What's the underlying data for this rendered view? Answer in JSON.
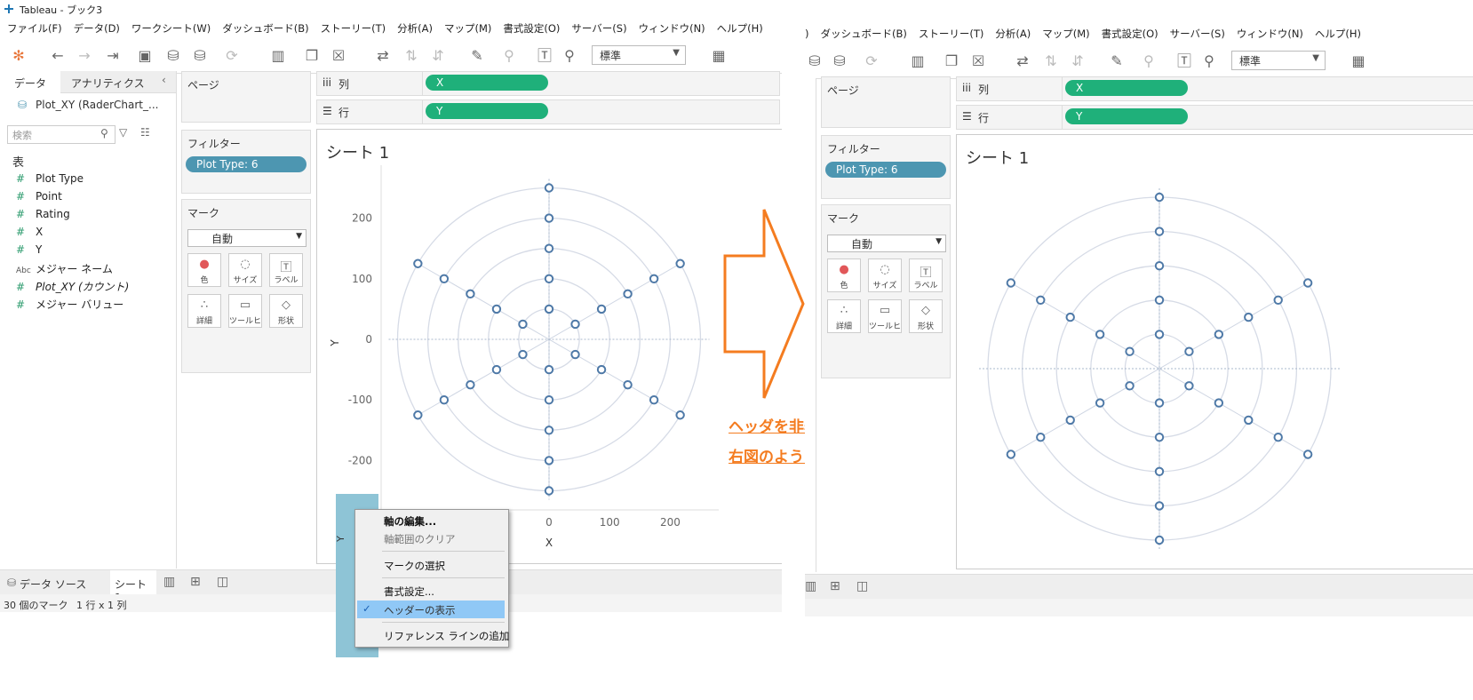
{
  "window": {
    "title": "Tableau - ブック3"
  },
  "menu": [
    "ファイル(F)",
    "データ(D)",
    "ワークシート(W)",
    "ダッシュボード(B)",
    "ストーリー(T)",
    "分析(A)",
    "マップ(M)",
    "書式設定(O)",
    "サーバー(S)",
    "ウィンドウ(N)",
    "ヘルプ(H)"
  ],
  "menu_right": ")",
  "toolbar": {
    "standard_label": "標準"
  },
  "data_pane": {
    "tab_data": "データ",
    "tab_analytics": "アナリティクス",
    "datasource": "Plot_XY (RaderChart_...",
    "search_placeholder": "検索",
    "table_header": "表",
    "fields": [
      {
        "name": "Plot Type",
        "type": "measure"
      },
      {
        "name": "Point",
        "type": "measure"
      },
      {
        "name": "Rating",
        "type": "measure"
      },
      {
        "name": "X",
        "type": "measure"
      },
      {
        "name": "Y",
        "type": "measure"
      },
      {
        "name": "メジャー ネーム",
        "type": "dimension-abc"
      },
      {
        "name": "Plot_XY (カウント)",
        "type": "measure"
      },
      {
        "name": "メジャー バリュー",
        "type": "measure"
      }
    ]
  },
  "cards": {
    "pages_title": "ページ",
    "filters_title": "フィルター",
    "filter_pill": "Plot Type: 6",
    "marks_title": "マーク",
    "marks_type": "自動",
    "mark_buttons": [
      "色",
      "サイズ",
      "ラベル",
      "詳細",
      "ツールヒ...",
      "形状"
    ]
  },
  "shelves": {
    "columns_label": "列",
    "rows_label": "行",
    "columns_pill": "X",
    "rows_pill": "Y"
  },
  "sheet": {
    "title": "シート 1",
    "x_axis_title": "X",
    "y_axis_title": "Y",
    "y_ticks": [
      "200",
      "100",
      "0",
      "-100",
      "-200"
    ],
    "x_ticks": [
      "0",
      "100",
      "200"
    ]
  },
  "context_menu": {
    "items": [
      "軸の編集...",
      "軸範囲のクリア",
      "マークの選択",
      "書式設定...",
      "ヘッダーの表示",
      "リファレンス ラインの追加"
    ],
    "checked_item": "ヘッダーの表示"
  },
  "bottom": {
    "datasource_tab": "データ ソース",
    "sheet_tab": "シート 1",
    "status_marks": "30 個のマーク",
    "status_dims": "1 行 x 1 列"
  },
  "annotation": {
    "line1": "ヘッダを非表示にすると",
    "line2": "右図のようになります。"
  },
  "chart_data": {
    "type": "scatter",
    "title": "シート 1",
    "xlabel": "X",
    "ylabel": "Y",
    "xlim": [
      -250,
      250
    ],
    "ylim": [
      -250,
      250
    ],
    "rings": [
      50,
      100,
      150,
      200,
      250
    ],
    "x": [
      0,
      0,
      0,
      0,
      0,
      0,
      0,
      0,
      0,
      0,
      43.3,
      86.6,
      129.9,
      173.2,
      216.5,
      -43.3,
      -86.6,
      -129.9,
      -173.2,
      -216.5,
      43.3,
      86.6,
      129.9,
      173.2,
      216.5,
      -43.3,
      -86.6,
      -129.9,
      -173.2,
      -216.5
    ],
    "y": [
      50,
      100,
      150,
      200,
      250,
      -50,
      -100,
      -150,
      -200,
      -250,
      25,
      50,
      75,
      100,
      125,
      25,
      50,
      75,
      100,
      125,
      -25,
      -50,
      -75,
      -100,
      -125,
      -25,
      -50,
      -75,
      -100,
      -125
    ],
    "marker": "open-circle",
    "color": "#4e79a7",
    "grid": true
  }
}
